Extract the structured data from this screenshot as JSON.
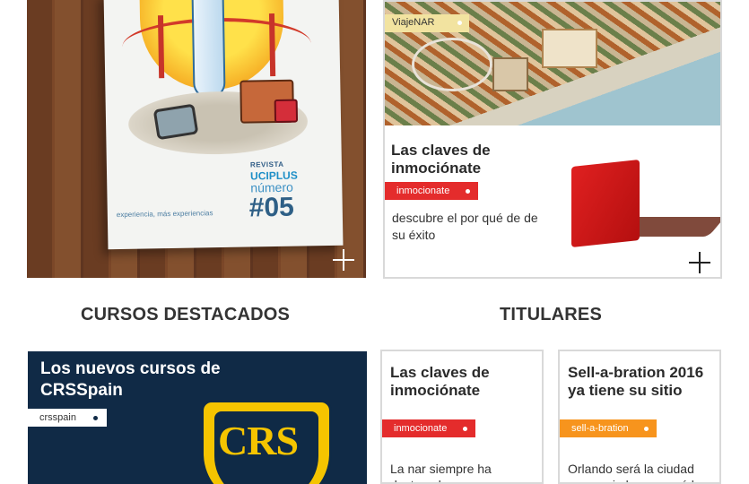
{
  "featured": {
    "magazine": {
      "revista_label": "REVISTA",
      "brand": "UCIPLUS",
      "numero_label": "número",
      "issue": "#05",
      "tagline": "experiencia, más experiencias"
    },
    "viaje": {
      "tag": "ViajeNAR",
      "title": "Las claves de inmociónate",
      "category": "inmocionate",
      "description": "descubre el por qué de de su éxito"
    }
  },
  "sections": {
    "cursos": "CURSOS DESTACADOS",
    "titulares": "TITULARES"
  },
  "cursos": {
    "card": {
      "title": "Los nuevos cursos de CRSSpain",
      "tag": "crsspain",
      "logo_text": "CRS"
    }
  },
  "titulares": [
    {
      "title": "Las claves de inmociónate",
      "category": "inmocionate",
      "category_color": "#e42c2c",
      "excerpt": "La nar siempre ha destacado por escoger"
    },
    {
      "title": "Sell-a-bration 2016 ya tiene su sitio",
      "category": "sell-a-bration",
      "category_color": "#f7941d",
      "excerpt": "Orlando será la ciudad que acoja la que será la"
    }
  ],
  "icons": {
    "expand": "plus-icon"
  }
}
